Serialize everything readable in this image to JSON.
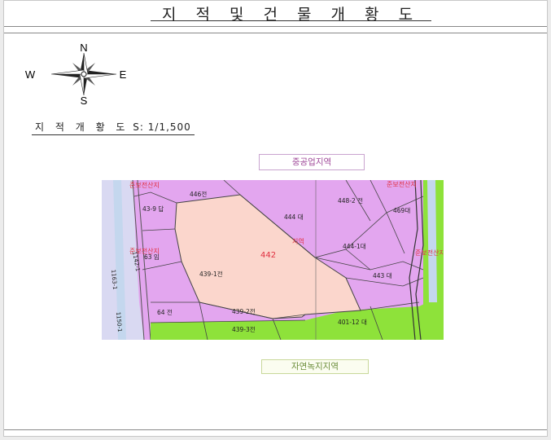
{
  "page": {
    "title": "지 적 및 건 물 개 황 도"
  },
  "compass": {
    "north": "N",
    "south": "S",
    "east": "E",
    "west": "W"
  },
  "scale": {
    "label": "지 적 개 황 도",
    "value": "S: 1/1,500"
  },
  "zones": {
    "top_tag": "중공업지역",
    "bottom_tag": "자연녹지지역",
    "left_top": "준보전산지",
    "left_mid": "준보전산지",
    "right_top": "준보전산지",
    "right_mid": "준보전산지",
    "subject_zone": "지역"
  },
  "parcels": {
    "subject": "442",
    "p446": "446전",
    "p448_2": "448-2 전",
    "p444": "444 대",
    "p469": "469대",
    "p43_9": "43-9 답",
    "p63": "63 임",
    "p444_1": "444-1대",
    "p439_1": "439-1전",
    "p443": "443 대",
    "p64": "64 전",
    "p439_2": "439-2전",
    "p401_12": "401-12 대",
    "p439_3": "439-3전",
    "p1142": "1142-1",
    "p1163": "1163-1",
    "p1150": "1150-1"
  },
  "colors": {
    "zone_purple": "#e3a6ef",
    "zone_green": "#8ee23a",
    "subject_fill": "#fbd6cc",
    "road_blue": "#c4d7ee",
    "label_red": "#e03040"
  }
}
